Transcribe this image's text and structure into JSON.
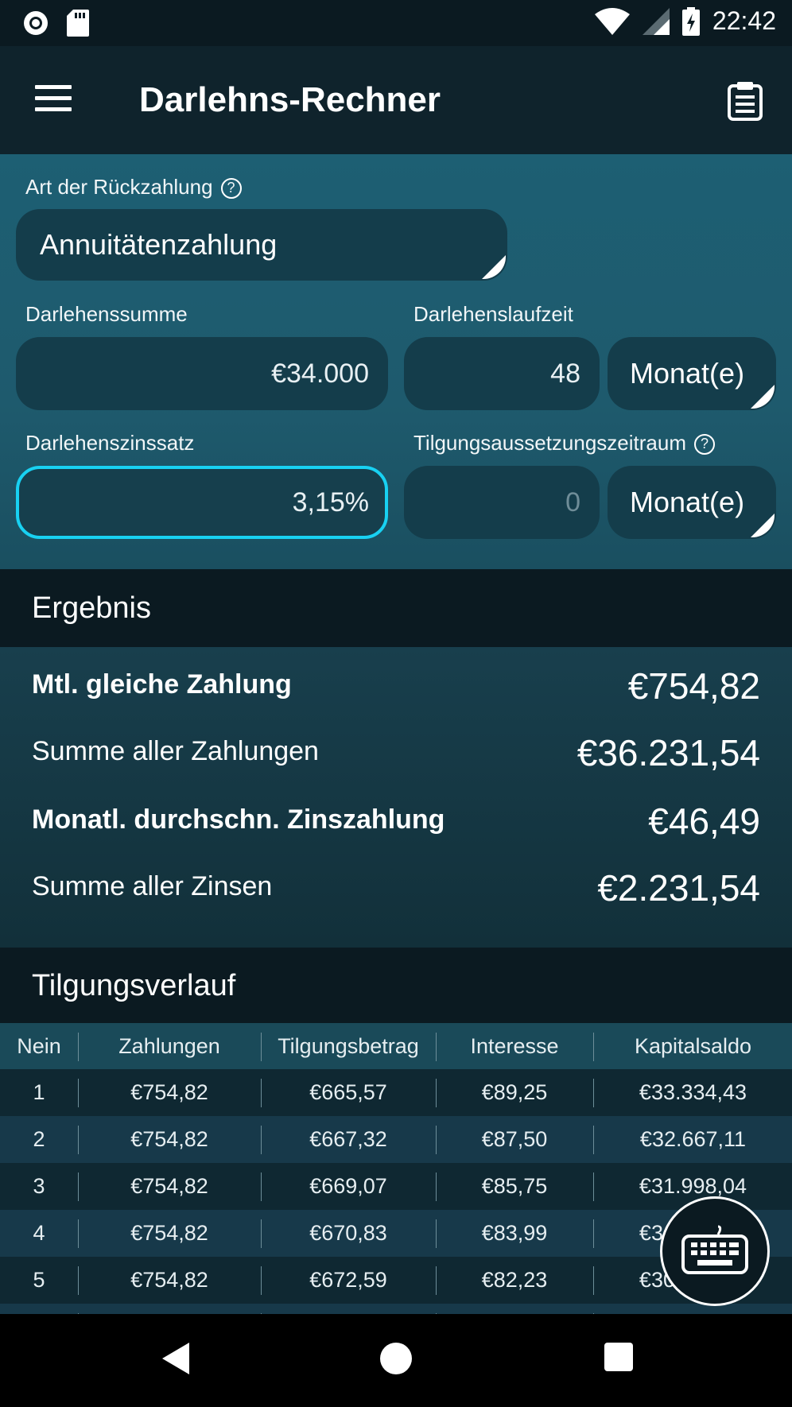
{
  "status_bar": {
    "time": "22:42"
  },
  "app_bar": {
    "title": "Darlehns-Rechner"
  },
  "form": {
    "repayment_type": {
      "label": "Art der Rückzahlung",
      "value": "Annuitätenzahlung"
    },
    "loan_amount": {
      "label": "Darlehenssumme",
      "value": "€34.000"
    },
    "loan_term": {
      "label": "Darlehenslaufzeit",
      "value": "48",
      "unit": "Monat(e)"
    },
    "interest_rate": {
      "label": "Darlehenszinssatz",
      "value": "3,15%"
    },
    "grace_period": {
      "label": "Tilgungsaussetzungszeitraum",
      "value": "0",
      "unit": "Monat(e)"
    }
  },
  "results": {
    "header": "Ergebnis",
    "rows": [
      {
        "label": "Mtl. gleiche Zahlung",
        "value": "€754,82"
      },
      {
        "label": "Summe aller Zahlungen",
        "value": "€36.231,54"
      },
      {
        "label": "Monatl. durchschn. Zinszahlung",
        "value": "€46,49"
      },
      {
        "label": "Summe aller Zinsen",
        "value": "€2.231,54"
      }
    ]
  },
  "schedule": {
    "header": "Tilgungsverlauf",
    "columns": [
      "Nein",
      "Zahlungen",
      "Tilgungsbetrag",
      "Interesse",
      "Kapitalsaldo"
    ],
    "rows": [
      [
        "1",
        "€754,82",
        "€665,57",
        "€89,25",
        "€33.334,43"
      ],
      [
        "2",
        "€754,82",
        "€667,32",
        "€87,50",
        "€32.667,11"
      ],
      [
        "3",
        "€754,82",
        "€669,07",
        "€85,75",
        "€31.998,04"
      ],
      [
        "4",
        "€754,82",
        "€670,83",
        "€83,99",
        "€31.327,21"
      ],
      [
        "5",
        "€754,82",
        "€672,59",
        "€82,23",
        "€30.654,62"
      ]
    ]
  },
  "icons": {
    "menu": "hamburger-icon",
    "clipboard": "clipboard-icon",
    "help": "help-circle-icon",
    "keyboard": "keyboard-icon"
  },
  "colors": {
    "accent_focus": "#18d1f2",
    "app_bar": "#0f232c",
    "input_bg": "#143d4b"
  }
}
